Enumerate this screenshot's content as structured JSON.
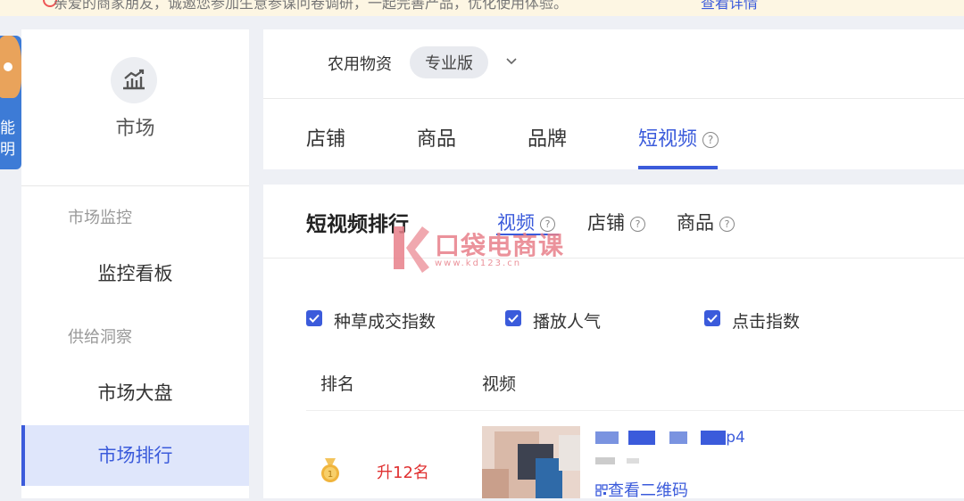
{
  "banner": {
    "text": "亲爱的商家朋友，诚邀您参加生意参谋问卷调研，一起完善产品，优化使用体验。",
    "link": "查看详情"
  },
  "mascot": {
    "text": "能明"
  },
  "sidebar": {
    "title": "市场",
    "groups": [
      {
        "label": "市场监控",
        "items": [
          "监控看板"
        ]
      },
      {
        "label": "供给洞察",
        "items": [
          "市场大盘",
          "市场排行"
        ]
      }
    ],
    "active": "市场排行"
  },
  "header": {
    "industry": "农用物资",
    "edition": "专业版",
    "tabs": [
      "店铺",
      "商品",
      "品牌",
      "短视频"
    ],
    "active_tab": "短视频"
  },
  "ranking": {
    "title": "短视频排行",
    "sub_tabs": [
      "视频",
      "店铺",
      "商品"
    ],
    "active_sub_tab": "视频",
    "metrics": [
      "种草成交指数",
      "播放人气",
      "点击指数"
    ],
    "columns": [
      "排名",
      "视频"
    ],
    "rows": [
      {
        "rank_change": "升12名",
        "video_title_tail": "p4",
        "qr_link": "查看二维码"
      }
    ]
  },
  "watermark": {
    "text": "口袋电商课",
    "url": "www.kd123.cn"
  },
  "colors": {
    "accent": "#3b5bdb",
    "up": "#e03131",
    "active_bg": "#dfe6fb"
  }
}
